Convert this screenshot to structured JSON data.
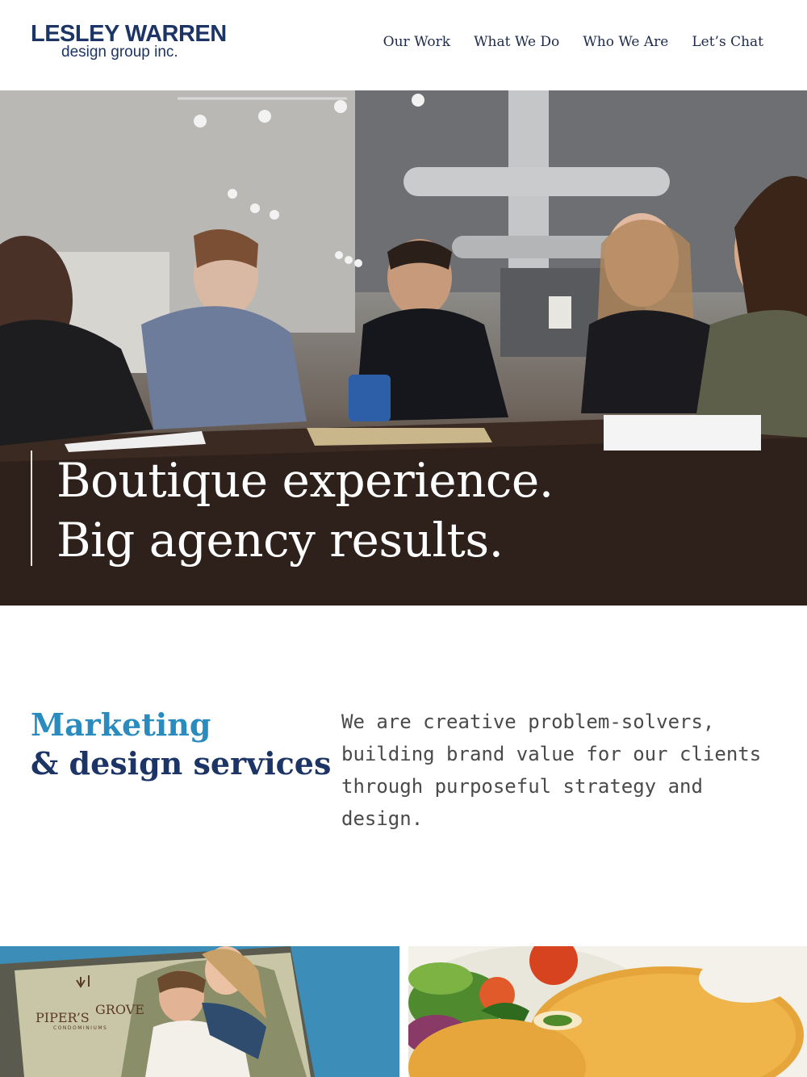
{
  "brand": {
    "name_line1": "LESLEY WARREN",
    "name_line2": "design group inc.",
    "color": "#1d3566"
  },
  "nav": {
    "items": [
      {
        "label": "Our Work"
      },
      {
        "label": "What We Do"
      },
      {
        "label": "Who We Are"
      },
      {
        "label": "Let’s Chat"
      }
    ]
  },
  "hero": {
    "line1": "Boutique experience.",
    "line2": "Big agency results."
  },
  "intro": {
    "title_line1": "Marketing",
    "title_line2": "& design services",
    "body": "We are creative problem-solvers, building brand value for our clients through purposeful strategy and design.",
    "accent_color": "#2a8bbf"
  },
  "portfolio": {
    "tile1": {
      "logo_text": "PIPER’S GROVE",
      "logo_sub": "CONDOMINIUMS"
    }
  }
}
